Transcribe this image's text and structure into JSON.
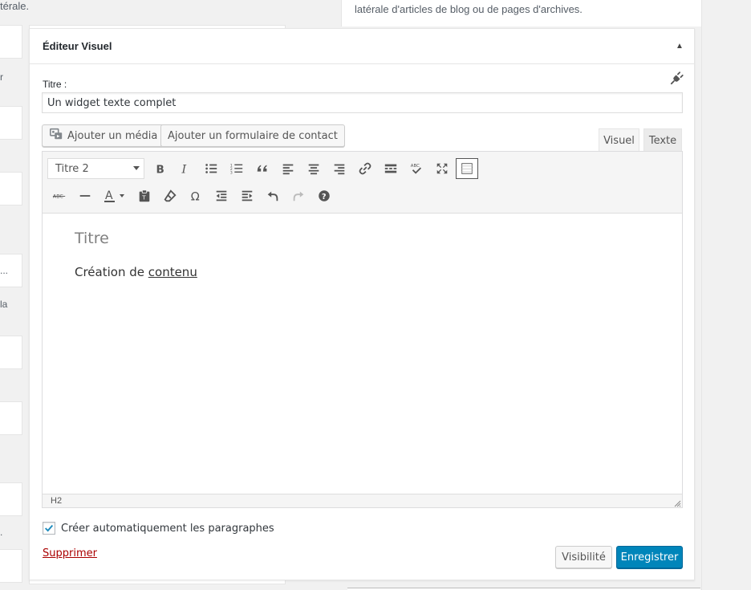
{
  "background": {
    "top_left_text": "térale.",
    "right_panel_text": "latérale d'articles de blog ou de pages d'archives.",
    "left_fragments": [
      "r",
      "...",
      "la",
      "."
    ]
  },
  "widget": {
    "title": "Éditeur Visuel",
    "toggle_glyph": "▲",
    "title_label": "Titre :",
    "title_value": "Un widget texte complet",
    "add_media_label": "Ajouter un média",
    "add_form_label": "Ajouter un formulaire de contact",
    "tabs": {
      "visual": "Visuel",
      "text": "Texte"
    },
    "format_select_value": "Titre 2",
    "content": {
      "heading": "Titre",
      "paragraph_prefix": "Création de ",
      "paragraph_link": "contenu"
    },
    "status_path": "H2",
    "autop_label": "Créer automatiquement les paragraphes",
    "autop_checked": true,
    "delete_label": "Supprimer",
    "visibility_label": "Visibilité",
    "save_label": "Enregistrer"
  },
  "colors": {
    "primary": "#0085ba",
    "delete": "#a00",
    "toolbar_bg": "#f5f5f5"
  }
}
